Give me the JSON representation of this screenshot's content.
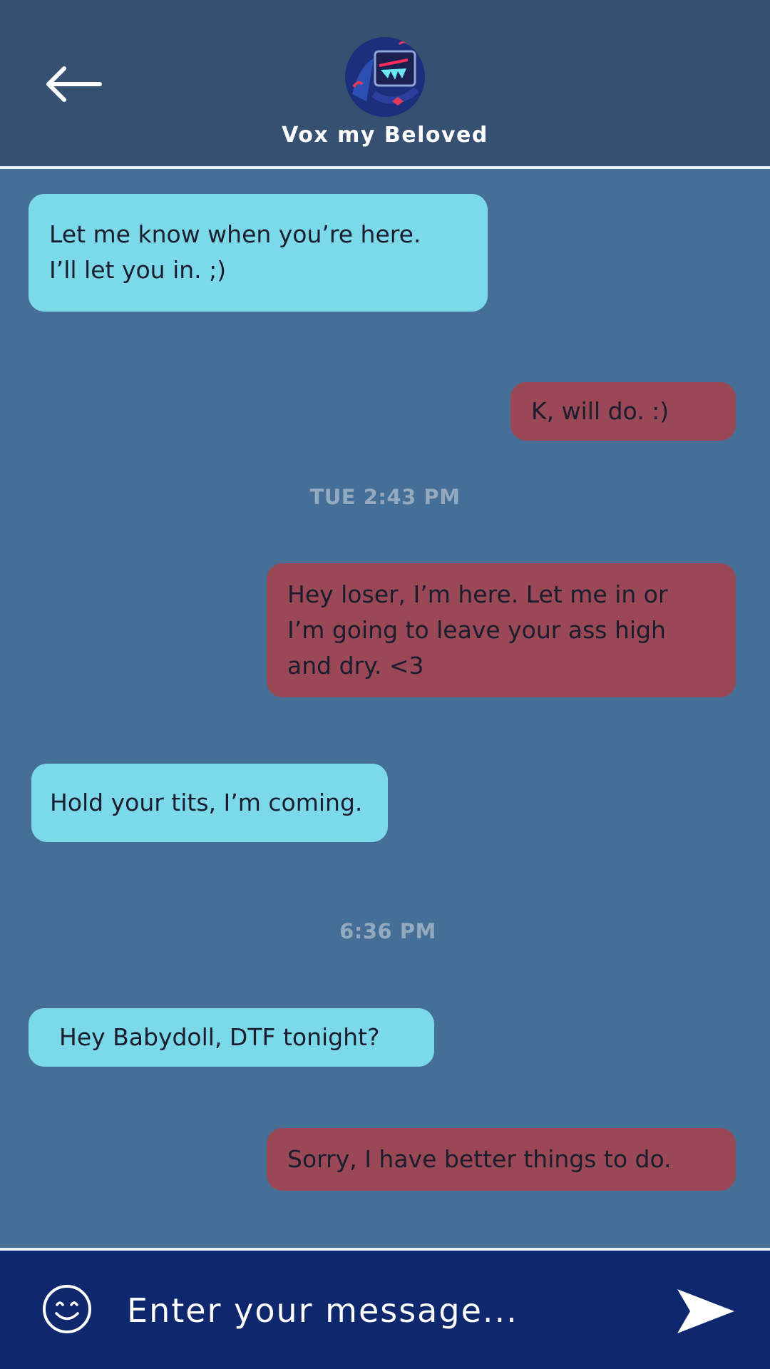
{
  "header": {
    "contact_name": "Vox my Beloved",
    "back_icon": "arrow-left-icon",
    "avatar": "contact-avatar"
  },
  "messages": [
    {
      "direction": "incoming",
      "lines": [
        "Let me know when you’re here.",
        "I’ll let you in. ;)"
      ]
    },
    {
      "direction": "outgoing",
      "lines": [
        "K, will do. :)"
      ]
    },
    {
      "type": "timestamp",
      "text": "TUE 2:43 PM"
    },
    {
      "direction": "outgoing",
      "lines": [
        "Hey loser, I’m here. Let me in or",
        "I’m going to leave your ass high",
        "and dry. <3"
      ]
    },
    {
      "direction": "incoming",
      "lines": [
        "Hold your tits, I’m coming."
      ]
    },
    {
      "type": "timestamp",
      "text": "6:36 PM"
    },
    {
      "direction": "incoming",
      "lines": [
        "Hey Babydoll, DTF tonight?"
      ]
    },
    {
      "direction": "outgoing",
      "lines": [
        "Sorry, I have better things to do."
      ]
    }
  ],
  "composer": {
    "placeholder": "Enter your message...",
    "emoji_icon": "smiley-face-icon",
    "send_icon": "send-arrow-icon"
  },
  "colors": {
    "header_bg": "#365071",
    "chat_bg": "#456f96",
    "incoming_bubble": "#7cd9e9",
    "outgoing_bubble": "#9a4856",
    "footer_bg": "#0f286d",
    "timestamp": "#93a9c0"
  }
}
